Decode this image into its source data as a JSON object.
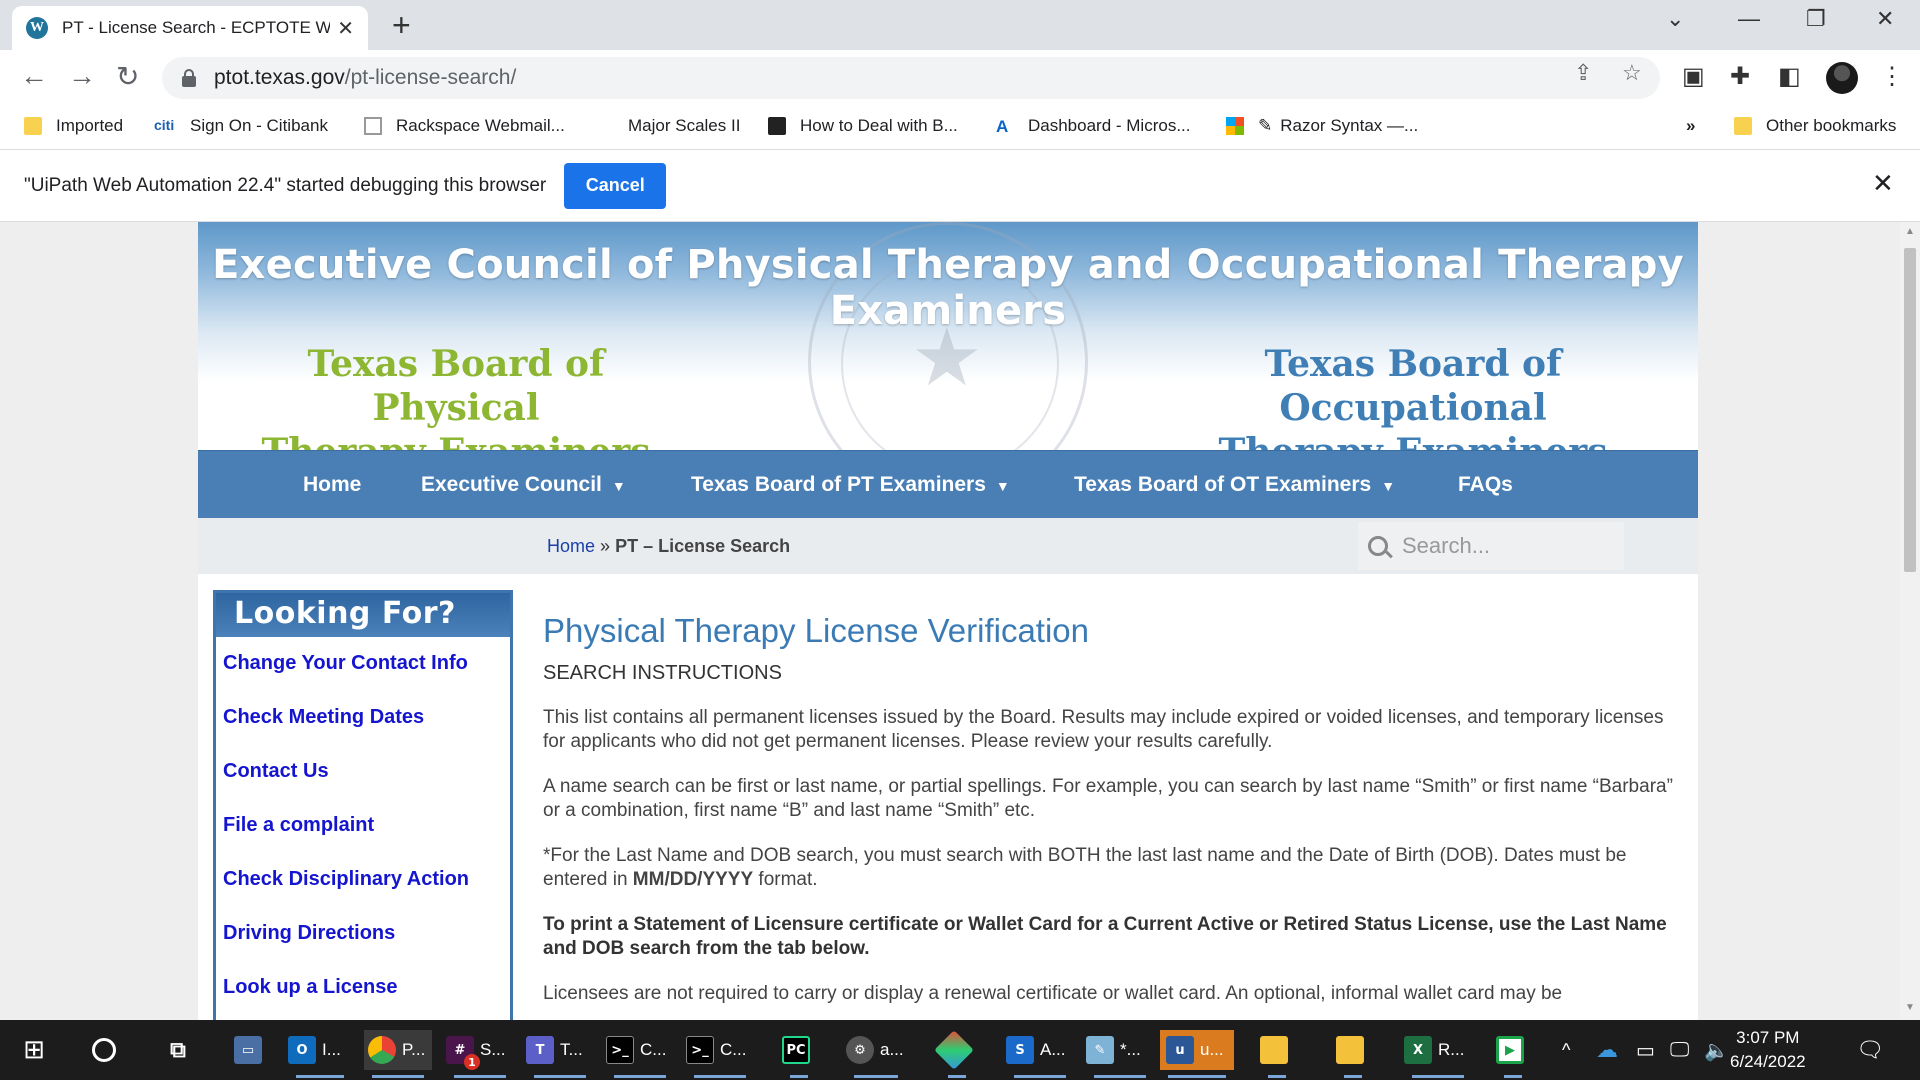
{
  "browser": {
    "tab_title": "PT - License Search - ECPTOTE W",
    "url_domain": "ptot.texas.gov",
    "url_path": "/pt-license-search/",
    "bookmarks": [
      "Imported",
      "Sign On - Citibank",
      "Rackspace Webmail...",
      "Major Scales II",
      "How to Deal with B...",
      "Dashboard - Micros...",
      "Razor Syntax —...",
      "»",
      "Other bookmarks"
    ],
    "infobar_message": "\"UiPath Web Automation 22.4\" started debugging this browser",
    "infobar_cancel": "Cancel"
  },
  "site": {
    "banner_title": "Executive Council of Physical Therapy and Occupational Therapy Examiners",
    "board_pt_line1": "Texas Board of Physical",
    "board_pt_line2": "Therapy Examiners",
    "board_ot_line1": "Texas Board of Occupational",
    "board_ot_line2": "Therapy Examiners",
    "nav": {
      "home": "Home",
      "executive": "Executive Council",
      "pt": "Texas Board of PT Examiners",
      "ot": "Texas Board of OT Examiners",
      "faqs": "FAQs"
    },
    "breadcrumb_home": "Home",
    "breadcrumb_sep": "»",
    "breadcrumb_current": "PT – License Search",
    "search_placeholder": "Search..."
  },
  "sidebar": {
    "heading": "Looking For?",
    "links": [
      "Change Your Contact Info",
      "Check Meeting Dates",
      "Contact Us",
      "File a complaint",
      "Check Disciplinary Action",
      "Driving Directions",
      "Look up a License"
    ]
  },
  "content": {
    "title": "Physical Therapy License Verification",
    "subtitle": "SEARCH INSTRUCTIONS",
    "p1": "This list contains all permanent licenses issued by the Board.  Results may include expired or voided licenses, and temporary licenses for applicants who did not get permanent licenses.  Please review your results carefully.",
    "p2": "A name search can be first or last name, or partial spellings.  For example, you can search by last name “Smith” or first name “Barbara” or a combination, first name “B” and last name “Smith” etc.",
    "p3_before": "*For the Last Name and DOB search, you must search with BOTH the last last name and the Date of Birth (DOB).  Dates must be entered in ",
    "p3_format": "MM/DD/YYYY",
    "p3_after": " format.",
    "p4": "To print a Statement of Licensure certificate or Wallet Card for a Current Active or Retired Status License, use the Last Name and DOB search from the tab below.",
    "p5": "Licensees are not required to carry or display a renewal certificate or wallet card. An optional, informal wallet card may be"
  },
  "taskbar": {
    "items": [
      "I...",
      "P...",
      "S...",
      "T...",
      "C...",
      "C...",
      "a...",
      "A...",
      "*...",
      "u...",
      "R..."
    ],
    "badge": "1",
    "time": "3:07 PM",
    "date": "6/24/2022"
  }
}
